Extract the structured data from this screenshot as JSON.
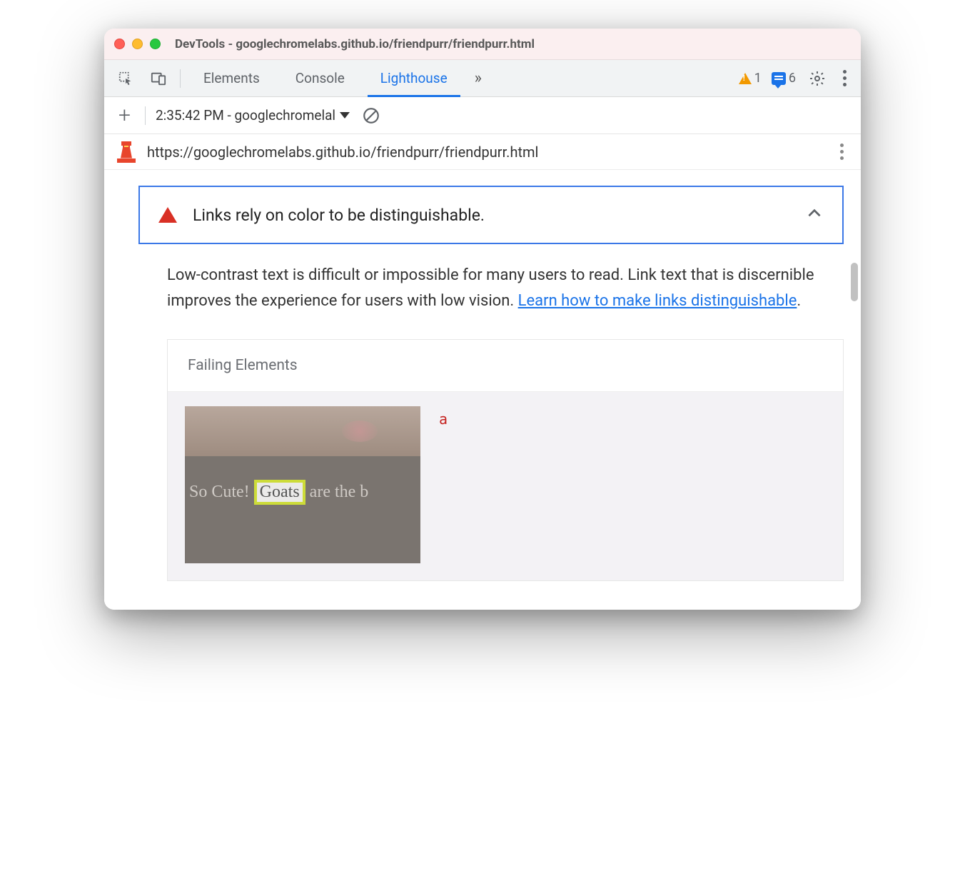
{
  "window": {
    "title": "DevTools - googlechromelabs.github.io/friendpurr/friendpurr.html"
  },
  "tabs": {
    "elements": "Elements",
    "console": "Console",
    "lighthouse": "Lighthouse",
    "more_glyph": "»",
    "warning_count": "1",
    "message_count": "6"
  },
  "reportbar": {
    "report_label": "2:35:42 PM - googlechromelal"
  },
  "urlbar": {
    "url": "https://googlechromelabs.github.io/friendpurr/friendpurr.html"
  },
  "audit": {
    "title": "Links rely on color to be distinguishable.",
    "desc_pre": "Low-contrast text is difficult or impossible for many users to read. Link text that is discernible improves the experience for users with low vision. ",
    "desc_link": "Learn how to make links distinguishable",
    "desc_post": "."
  },
  "failing": {
    "header": "Failing Elements",
    "element_tag": "a",
    "thumb_text_pre": "So Cute! ",
    "thumb_text_hl": "Goats",
    "thumb_text_post": " are the b"
  }
}
